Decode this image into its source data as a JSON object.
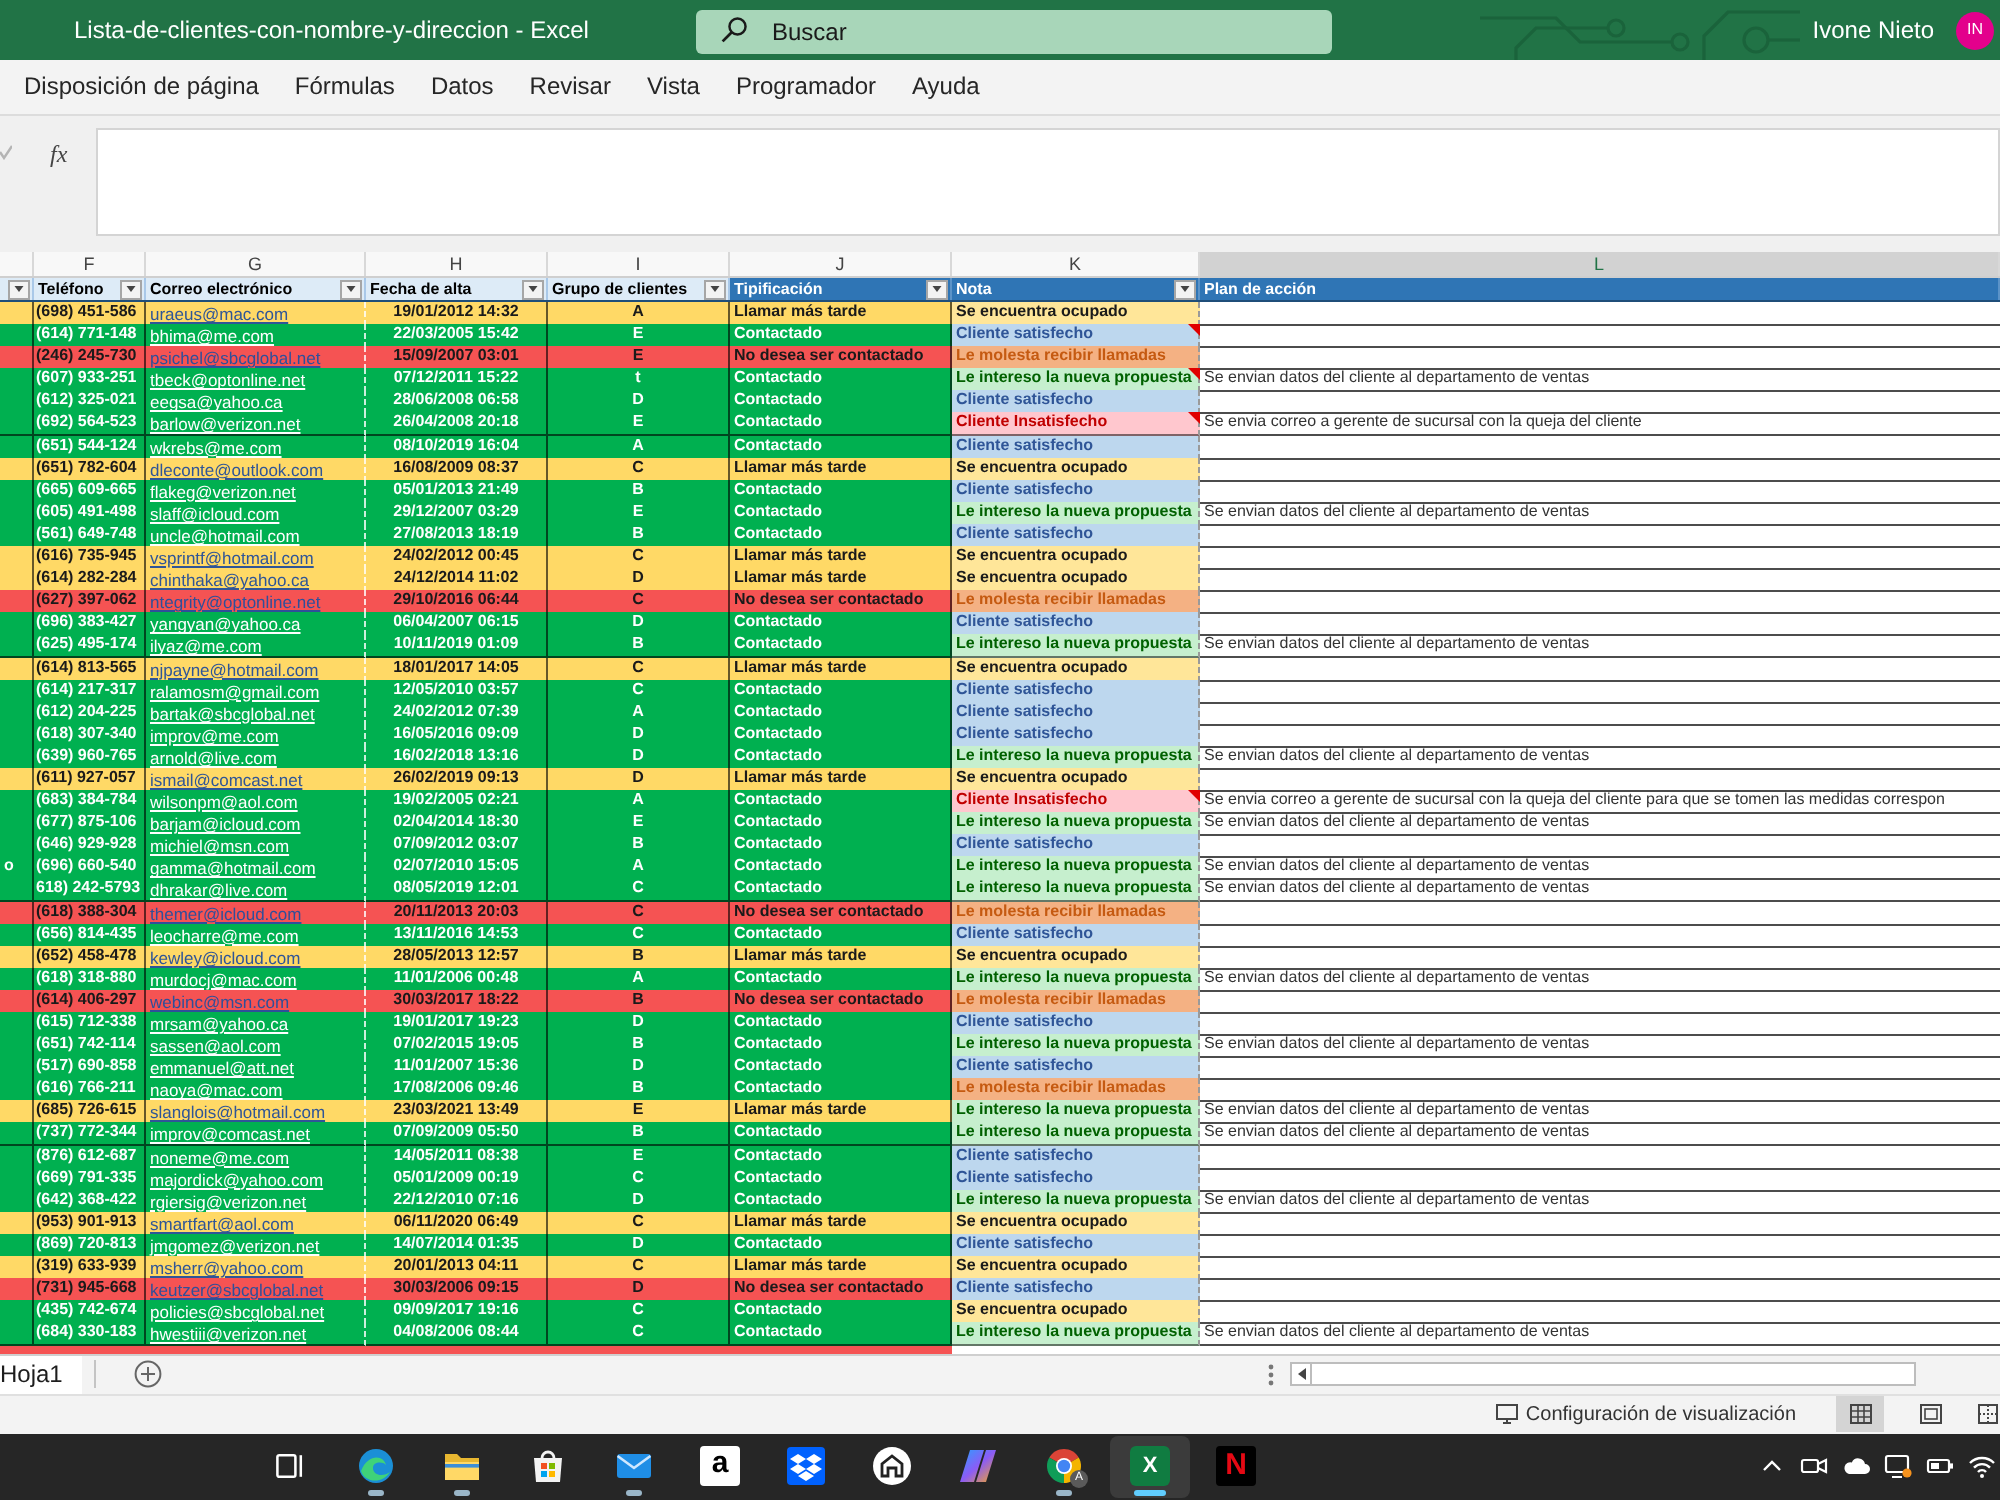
{
  "window": {
    "title": "Lista-de-clientes-con-nombre-y-direccion - Excel",
    "user": "Ivone Nieto",
    "avatar": "IN"
  },
  "search": {
    "placeholder": "Buscar"
  },
  "ribbon_tabs": [
    {
      "label": "Disposición de página",
      "selected": false
    },
    {
      "label": "Fórmulas",
      "selected": false
    },
    {
      "label": "Datos",
      "selected": false
    },
    {
      "label": "Revisar",
      "selected": false
    },
    {
      "label": "Vista",
      "selected": false
    },
    {
      "label": "Programador",
      "selected": false
    },
    {
      "label": "Ayuda",
      "selected": false
    }
  ],
  "formula_bar": {
    "function_label": "fx"
  },
  "column_letters": [
    {
      "label": "F",
      "selected": false
    },
    {
      "label": "G",
      "selected": false
    },
    {
      "label": "H",
      "selected": false
    },
    {
      "label": "I",
      "selected": false
    },
    {
      "label": "J",
      "selected": false
    },
    {
      "label": "K",
      "selected": false
    },
    {
      "label": "L",
      "selected": true
    }
  ],
  "table": {
    "header": [
      {
        "kind": "plain",
        "filter": true
      },
      {
        "label": "Teléfono",
        "kind": "plain",
        "filter": true
      },
      {
        "label": "Correo electrónico",
        "kind": "plain",
        "filter": true
      },
      {
        "label": "Fecha de alta",
        "kind": "plain",
        "filter": true
      },
      {
        "label": "Grupo de clientes",
        "kind": "plain",
        "filter": true
      },
      {
        "label": "Tipificación",
        "kind": "accent",
        "filter": true
      },
      {
        "label": "Nota",
        "kind": "accent",
        "filter": true
      },
      {
        "label": "Plan de acción",
        "kind": "accent",
        "filter": false
      }
    ],
    "rows": [
      {
        "kind": "callback",
        "phone": "(698) 451-586",
        "email": "uraeus@mac.com",
        "date": "19/01/2012 14:32",
        "group": "A",
        "typification": "Llamar más tarde",
        "note": {
          "text": "Se encuentra ocupado",
          "kind": "busy"
        },
        "has_comment": false
      },
      {
        "kind": "contacted",
        "phone": "(614) 771-148",
        "email": "bhima@me.com",
        "date": "22/03/2005 15:42",
        "group": "E",
        "typification": "Contactado",
        "note": {
          "text": "Cliente satisfecho",
          "kind": "satisfied"
        },
        "has_comment": true
      },
      {
        "kind": "refused",
        "phone": "(246) 245-730",
        "email": "psichel@sbcglobal.net",
        "date": "15/09/2007 03:01",
        "group": "E",
        "typification": "No desea ser contactado",
        "note": {
          "text": "Le molesta recibir llamadas",
          "kind": "annoyed"
        },
        "has_comment": false
      },
      {
        "kind": "contacted",
        "phone": "(607) 933-251",
        "email": "tbeck@optonline.net",
        "date": "07/12/2011 15:22",
        "group": "t",
        "typification": "Contactado",
        "note": {
          "text": "Le intereso la nueva propuesta",
          "kind": "interested"
        },
        "has_comment": true,
        "plan": "Se envian datos del cliente al departamento de ventas"
      },
      {
        "kind": "contacted",
        "phone": "(612) 325-021",
        "email": "eegsa@yahoo.ca",
        "date": "28/06/2008 06:58",
        "group": "D",
        "typification": "Contactado",
        "note": {
          "text": "Cliente satisfecho",
          "kind": "satisfied"
        },
        "has_comment": false
      },
      {
        "kind": "contacted",
        "phone": "(692) 564-523",
        "email": "barlow@verizon.net",
        "date": "26/04/2008 20:18",
        "group": "E",
        "typification": "Contactado",
        "note": {
          "text": "Cliente Insatisfecho",
          "kind": "unsatisfied"
        },
        "has_comment": true,
        "plan": "Se envia correo a gerente de sucursal con la queja del cliente"
      },
      {
        "kind": "contacted",
        "phone": "(651) 544-124",
        "email": "wkrebs@me.com",
        "date": "08/10/2019 16:04",
        "group": "A",
        "typification": "Contactado",
        "note": {
          "text": "Cliente satisfecho",
          "kind": "satisfied"
        },
        "has_comment": false
      },
      {
        "kind": "callback",
        "phone": "(651) 782-604",
        "email": "dleconte@outlook.com",
        "date": "16/08/2009 08:37",
        "group": "C",
        "typification": "Llamar más tarde",
        "note": {
          "text": "Se encuentra ocupado",
          "kind": "busy"
        },
        "has_comment": false
      },
      {
        "kind": "contacted",
        "phone": "(665) 609-665",
        "email": "flakeg@verizon.net",
        "date": "05/01/2013 21:49",
        "group": "B",
        "typification": "Contactado",
        "note": {
          "text": "Cliente satisfecho",
          "kind": "satisfied"
        },
        "has_comment": false
      },
      {
        "kind": "contacted",
        "phone": "(605) 491-498",
        "email": "slaff@icloud.com",
        "date": "29/12/2007 03:29",
        "group": "E",
        "typification": "Contactado",
        "note": {
          "text": "Le intereso la nueva propuesta",
          "kind": "interested"
        },
        "has_comment": false,
        "plan": "Se envian datos del cliente al departamento de ventas"
      },
      {
        "kind": "contacted",
        "phone": "(561) 649-748",
        "email": "uncle@hotmail.com",
        "date": "27/08/2013 18:19",
        "group": "B",
        "typification": "Contactado",
        "note": {
          "text": "Cliente satisfecho",
          "kind": "satisfied"
        },
        "has_comment": false
      },
      {
        "kind": "callback",
        "phone": "(616) 735-945",
        "email": "vsprintf@hotmail.com",
        "date": "24/02/2012 00:45",
        "group": "C",
        "typification": "Llamar más tarde",
        "note": {
          "text": "Se encuentra ocupado",
          "kind": "busy"
        },
        "has_comment": false
      },
      {
        "kind": "callback",
        "phone": "(614) 282-284",
        "email": "chinthaka@yahoo.ca",
        "date": "24/12/2014 11:02",
        "group": "D",
        "typification": "Llamar más tarde",
        "note": {
          "text": "Se encuentra ocupado",
          "kind": "busy"
        },
        "has_comment": false
      },
      {
        "kind": "refused",
        "phone": "(627) 397-062",
        "email": "ntegrity@optonline.net",
        "date": "29/10/2016 06:44",
        "group": "C",
        "typification": "No desea ser contactado",
        "note": {
          "text": "Le molesta recibir llamadas",
          "kind": "annoyed"
        },
        "has_comment": false
      },
      {
        "kind": "contacted",
        "phone": "(696) 383-427",
        "email": "yangyan@yahoo.ca",
        "date": "06/04/2007 06:15",
        "group": "D",
        "typification": "Contactado",
        "note": {
          "text": "Cliente satisfecho",
          "kind": "satisfied"
        },
        "has_comment": false
      },
      {
        "kind": "contacted",
        "phone": "(625) 495-174",
        "email": "ilyaz@me.com",
        "date": "10/11/2019 01:09",
        "group": "B",
        "typification": "Contactado",
        "note": {
          "text": "Le intereso la nueva propuesta",
          "kind": "interested"
        },
        "has_comment": false,
        "plan": "Se envian datos del cliente al departamento de ventas"
      },
      {
        "kind": "callback",
        "phone": "(614) 813-565",
        "email": "njpayne@hotmail.com",
        "date": "18/01/2017 14:05",
        "group": "C",
        "typification": "Llamar más tarde",
        "note": {
          "text": "Se encuentra ocupado",
          "kind": "busy"
        },
        "has_comment": false
      },
      {
        "kind": "contacted",
        "phone": "(614) 217-317",
        "email": "ralamosm@gmail.com",
        "date": "12/05/2010 03:57",
        "group": "C",
        "typification": "Contactado",
        "note": {
          "text": "Cliente satisfecho",
          "kind": "satisfied"
        },
        "has_comment": false
      },
      {
        "kind": "contacted",
        "phone": "(612) 204-225",
        "email": "bartak@sbcglobal.net",
        "date": "24/02/2012 07:39",
        "group": "A",
        "typification": "Contactado",
        "note": {
          "text": "Cliente satisfecho",
          "kind": "satisfied"
        },
        "has_comment": false
      },
      {
        "kind": "contacted",
        "phone": "(618) 307-340",
        "email": "improv@me.com",
        "date": "16/05/2016 09:09",
        "group": "D",
        "typification": "Contactado",
        "note": {
          "text": "Cliente satisfecho",
          "kind": "satisfied"
        },
        "has_comment": false
      },
      {
        "kind": "contacted",
        "phone": "(639) 960-765",
        "email": "arnold@live.com",
        "date": "16/02/2018 13:16",
        "group": "D",
        "typification": "Contactado",
        "note": {
          "text": "Le intereso la nueva propuesta",
          "kind": "interested"
        },
        "has_comment": false,
        "plan": "Se envian datos del cliente al departamento de ventas"
      },
      {
        "kind": "callback",
        "phone": "(611) 927-057",
        "email": "ismail@comcast.net",
        "date": "26/02/2019 09:13",
        "group": "D",
        "typification": "Llamar más tarde",
        "note": {
          "text": "Se encuentra ocupado",
          "kind": "busy"
        },
        "has_comment": false
      },
      {
        "kind": "contacted",
        "phone": "(683) 384-784",
        "email": "wilsonpm@aol.com",
        "date": "19/02/2005 02:21",
        "group": "A",
        "typification": "Contactado",
        "note": {
          "text": "Cliente Insatisfecho",
          "kind": "unsatisfied"
        },
        "has_comment": true,
        "plan": "Se envia correo a gerente de sucursal con la queja del cliente para que se tomen las medidas correspon"
      },
      {
        "kind": "contacted",
        "phone": "(677) 875-106",
        "email": "barjam@icloud.com",
        "date": "02/04/2014 18:30",
        "group": "E",
        "typification": "Contactado",
        "note": {
          "text": "Le intereso la nueva propuesta",
          "kind": "interested"
        },
        "has_comment": false,
        "plan": "Se envian datos del cliente al departamento de ventas"
      },
      {
        "kind": "contacted",
        "phone": "(646) 929-928",
        "email": "michiel@msn.com",
        "date": "07/09/2012 03:07",
        "group": "B",
        "typification": "Contactado",
        "note": {
          "text": "Cliente satisfecho",
          "kind": "satisfied"
        },
        "has_comment": false
      },
      {
        "kind": "contacted",
        "column_e": "o",
        "phone": "(696) 660-540",
        "email": "gamma@hotmail.com",
        "date": "02/07/2010 15:05",
        "group": "A",
        "typification": "Contactado",
        "note": {
          "text": "Le intereso la nueva propuesta",
          "kind": "interested"
        },
        "has_comment": false,
        "plan": "Se envian datos del cliente al departamento de ventas"
      },
      {
        "kind": "contacted",
        "phone": "618) 242-5793",
        "email": "dhrakar@live.com",
        "date": "08/05/2019 12:01",
        "group": "C",
        "typification": "Contactado",
        "note": {
          "text": "Le intereso la nueva propuesta",
          "kind": "interested"
        },
        "has_comment": false,
        "plan": "Se envian datos del cliente al departamento de ventas"
      },
      {
        "kind": "refused",
        "phone": "(618) 388-304",
        "email": "themer@icloud.com",
        "date": "20/11/2013 20:03",
        "group": "C",
        "typification": "No desea ser contactado",
        "note": {
          "text": "Le molesta recibir llamadas",
          "kind": "annoyed"
        },
        "has_comment": false
      },
      {
        "kind": "contacted",
        "phone": "(656) 814-435",
        "email": "leocharre@me.com",
        "date": "13/11/2016 14:53",
        "group": "C",
        "typification": "Contactado",
        "note": {
          "text": "Cliente satisfecho",
          "kind": "satisfied"
        },
        "has_comment": false
      },
      {
        "kind": "callback",
        "phone": "(652) 458-478",
        "email": "kewley@icloud.com",
        "date": "28/05/2013 12:57",
        "group": "B",
        "typification": "Llamar más tarde",
        "note": {
          "text": "Se encuentra ocupado",
          "kind": "busy"
        },
        "has_comment": false
      },
      {
        "kind": "contacted",
        "phone": "(618) 318-880",
        "email": "murdocj@mac.com",
        "date": "11/01/2006 00:48",
        "group": "A",
        "typification": "Contactado",
        "note": {
          "text": "Le intereso la nueva propuesta",
          "kind": "interested"
        },
        "has_comment": false,
        "plan": "Se envian datos del cliente al departamento de ventas"
      },
      {
        "kind": "refused",
        "phone": "(614) 406-297",
        "email": "webinc@msn.com",
        "date": "30/03/2017 18:22",
        "group": "B",
        "typification": "No desea ser contactado",
        "note": {
          "text": "Le molesta recibir llamadas",
          "kind": "annoyed"
        },
        "has_comment": false
      },
      {
        "kind": "contacted",
        "phone": "(615) 712-338",
        "email": "mrsam@yahoo.ca",
        "date": "19/01/2017 19:23",
        "group": "D",
        "typification": "Contactado",
        "note": {
          "text": "Cliente satisfecho",
          "kind": "satisfied"
        },
        "has_comment": false
      },
      {
        "kind": "contacted",
        "phone": "(651) 742-114",
        "email": "sassen@aol.com",
        "date": "07/02/2015 19:05",
        "group": "B",
        "typification": "Contactado",
        "note": {
          "text": "Le intereso la nueva propuesta",
          "kind": "interested"
        },
        "has_comment": false,
        "plan": "Se envian datos del cliente al departamento de ventas"
      },
      {
        "kind": "contacted",
        "phone": "(517) 690-858",
        "email": "emmanuel@att.net",
        "date": "11/01/2007 15:36",
        "group": "D",
        "typification": "Contactado",
        "note": {
          "text": "Cliente satisfecho",
          "kind": "satisfied"
        },
        "has_comment": false
      },
      {
        "kind": "contacted",
        "phone": "(616) 766-211",
        "email": "naoya@mac.com",
        "date": "17/08/2006 09:46",
        "group": "B",
        "typification": "Contactado",
        "note": {
          "text": "Le molesta recibir llamadas",
          "kind": "annoyed"
        },
        "has_comment": false
      },
      {
        "kind": "callback",
        "phone": "(685) 726-615",
        "email": "slanglois@hotmail.com",
        "date": "23/03/2021 13:49",
        "group": "E",
        "typification": "Llamar más tarde",
        "note": {
          "text": "Le intereso la nueva propuesta",
          "kind": "interested"
        },
        "has_comment": false,
        "plan": "Se envian datos del cliente al departamento de ventas"
      },
      {
        "kind": "contacted",
        "phone": "(737) 772-344",
        "email": "improv@comcast.net",
        "date": "07/09/2009 05:50",
        "group": "B",
        "typification": "Contactado",
        "note": {
          "text": "Le intereso la nueva propuesta",
          "kind": "interested"
        },
        "has_comment": false,
        "plan": "Se envian datos del cliente al departamento de ventas"
      },
      {
        "kind": "contacted",
        "phone": "(876) 612-687",
        "email": "noneme@me.com",
        "date": "14/05/2011 08:38",
        "group": "E",
        "typification": "Contactado",
        "note": {
          "text": "Cliente satisfecho",
          "kind": "satisfied"
        },
        "has_comment": false
      },
      {
        "kind": "contacted",
        "phone": "(669) 791-335",
        "email": "majordick@yahoo.com",
        "date": "05/01/2009 00:19",
        "group": "C",
        "typification": "Contactado",
        "note": {
          "text": "Cliente satisfecho",
          "kind": "satisfied"
        },
        "has_comment": false
      },
      {
        "kind": "contacted",
        "phone": "(642) 368-422",
        "email": "rgiersig@verizon.net",
        "date": "22/12/2010 07:16",
        "group": "D",
        "typification": "Contactado",
        "note": {
          "text": "Le intereso la nueva propuesta",
          "kind": "interested"
        },
        "has_comment": false,
        "plan": "Se envian datos del cliente al departamento de ventas"
      },
      {
        "kind": "callback",
        "phone": "(953) 901-913",
        "email": "smartfart@aol.com",
        "date": "06/11/2020 06:49",
        "group": "C",
        "typification": "Llamar más tarde",
        "note": {
          "text": "Se encuentra ocupado",
          "kind": "busy"
        },
        "has_comment": false
      },
      {
        "kind": "contacted",
        "phone": "(869) 720-813",
        "email": "jmgomez@verizon.net",
        "date": "14/07/2014 01:35",
        "group": "D",
        "typification": "Contactado",
        "note": {
          "text": "Cliente satisfecho",
          "kind": "satisfied"
        },
        "has_comment": false
      },
      {
        "kind": "callback",
        "phone": "(319) 633-939",
        "email": "msherr@yahoo.com",
        "date": "20/01/2013 04:11",
        "group": "C",
        "typification": "Llamar más tarde",
        "note": {
          "text": "Se encuentra ocupado",
          "kind": "busy"
        },
        "has_comment": false
      },
      {
        "kind": "refused",
        "phone": "(731) 945-668",
        "email": "keutzer@sbcglobal.net",
        "date": "30/03/2006 09:15",
        "group": "D",
        "typification": "No desea ser contactado",
        "note": {
          "text": "Cliente satisfecho",
          "kind": "satisfied"
        },
        "has_comment": false
      },
      {
        "kind": "contacted",
        "phone": "(435) 742-674",
        "email": "policies@sbcglobal.net",
        "date": "09/09/2017 19:16",
        "group": "C",
        "typification": "Contactado",
        "note": {
          "text": "Se encuentra ocupado",
          "kind": "busy"
        },
        "has_comment": false
      },
      {
        "kind": "contacted",
        "phone": "(684) 330-183",
        "email": "hwestiii@verizon.net",
        "date": "04/08/2006 08:44",
        "group": "C",
        "typification": "Contactado",
        "note": {
          "text": "Le intereso la nueva propuesta",
          "kind": "interested"
        },
        "has_comment": false,
        "plan": "Se envian datos del cliente al departamento de ventas"
      }
    ],
    "cut_off_row": {
      "kind": "refused"
    }
  },
  "sheet_tabs": [
    {
      "label": "Hoja1",
      "selected": true
    }
  ],
  "status_bar": {
    "message": "Configuración de visualización",
    "views": [
      {
        "selected": true
      },
      {
        "selected": false
      },
      {
        "selected": false
      }
    ]
  },
  "taskbar": {
    "apps": [
      {
        "running": false,
        "selected": false
      },
      {
        "running": true,
        "selected": false
      },
      {
        "running": true,
        "selected": false
      },
      {
        "running": false,
        "selected": false
      },
      {
        "running": true,
        "selected": false
      },
      {
        "running": false,
        "selected": false,
        "glyph": "a"
      },
      {
        "running": false,
        "selected": false
      },
      {
        "running": false,
        "selected": false
      },
      {
        "running": false,
        "selected": false
      },
      {
        "running": true,
        "selected": false,
        "badge": "A"
      },
      {
        "running": true,
        "selected": true,
        "glyph": "X"
      },
      {
        "running": false,
        "selected": false,
        "glyph": "N"
      }
    ]
  }
}
